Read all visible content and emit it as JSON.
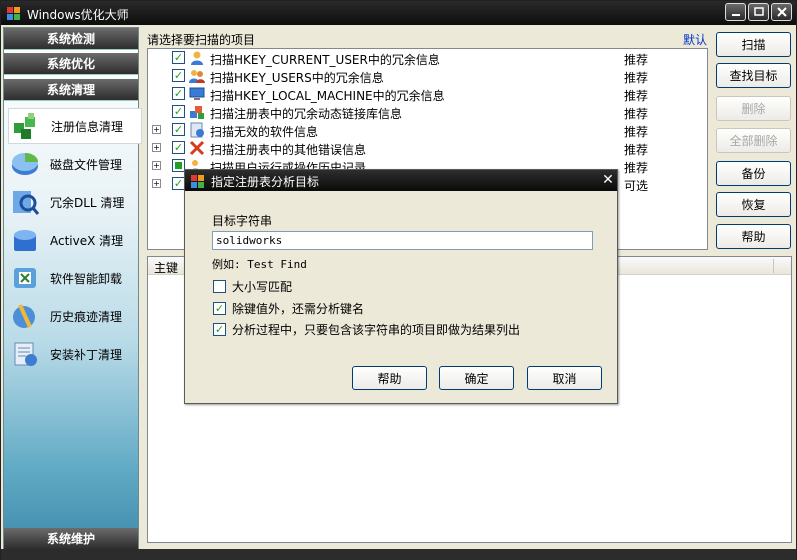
{
  "window": {
    "title": "Windows优化大师"
  },
  "sidebar": {
    "categories": [
      "系统检测",
      "系统优化",
      "系统清理"
    ],
    "bottom_category": "系统维护",
    "items": [
      {
        "label": "注册信息清理",
        "icon": "registry-cubes-icon",
        "selected": true
      },
      {
        "label": "磁盘文件管理",
        "icon": "disk-icon"
      },
      {
        "label": "冗余DLL 清理",
        "icon": "dll-search-icon"
      },
      {
        "label": "ActiveX 清理",
        "icon": "activex-box-icon"
      },
      {
        "label": "软件智能卸载",
        "icon": "uninstall-icon"
      },
      {
        "label": "历史痕迹清理",
        "icon": "broom-icon"
      },
      {
        "label": "安装补丁清理",
        "icon": "patch-icon"
      }
    ]
  },
  "main": {
    "heading": "请选择要扫描的项目",
    "default_link": "默认",
    "list": [
      {
        "text": "扫描HKEY_CURRENT_USER中的冗余信息",
        "tag": "推荐",
        "expandable": false,
        "checked": true
      },
      {
        "text": "扫描HKEY_USERS中的冗余信息",
        "tag": "推荐",
        "expandable": false,
        "checked": true
      },
      {
        "text": "扫描HKEY_LOCAL_MACHINE中的冗余信息",
        "tag": "推荐",
        "expandable": false,
        "checked": true
      },
      {
        "text": "扫描注册表中的冗余动态链接库信息",
        "tag": "推荐",
        "expandable": false,
        "checked": true
      },
      {
        "text": "扫描无效的软件信息",
        "tag": "推荐",
        "expandable": true,
        "checked": true
      },
      {
        "text": "扫描注册表中的其他错误信息",
        "tag": "推荐",
        "expandable": true,
        "checked": true
      },
      {
        "text": "扫描用户运行或操作历史记录",
        "tag": "推荐",
        "expandable": true,
        "checked": "partial"
      },
      {
        "text": "",
        "tag": "可选",
        "expandable": true,
        "checked": true
      }
    ],
    "detail_header": "主键"
  },
  "buttons": {
    "scan": "扫描",
    "find_target": "查找目标",
    "delete": "删除",
    "delete_all": "全部删除",
    "backup": "备份",
    "restore": "恢复",
    "help": "帮助"
  },
  "dialog": {
    "title": "指定注册表分析目标",
    "target_label": "目标字符串",
    "target_value": "solidworks",
    "example": "例如: Test Find",
    "options": [
      {
        "label": "大小写匹配",
        "checked": false
      },
      {
        "label": "除键值外，还需分析键名",
        "checked": true
      },
      {
        "label": "分析过程中，只要包含该字符串的项目即做为结果列出",
        "checked": true
      }
    ],
    "help": "帮助",
    "ok": "确定",
    "cancel": "取消"
  }
}
